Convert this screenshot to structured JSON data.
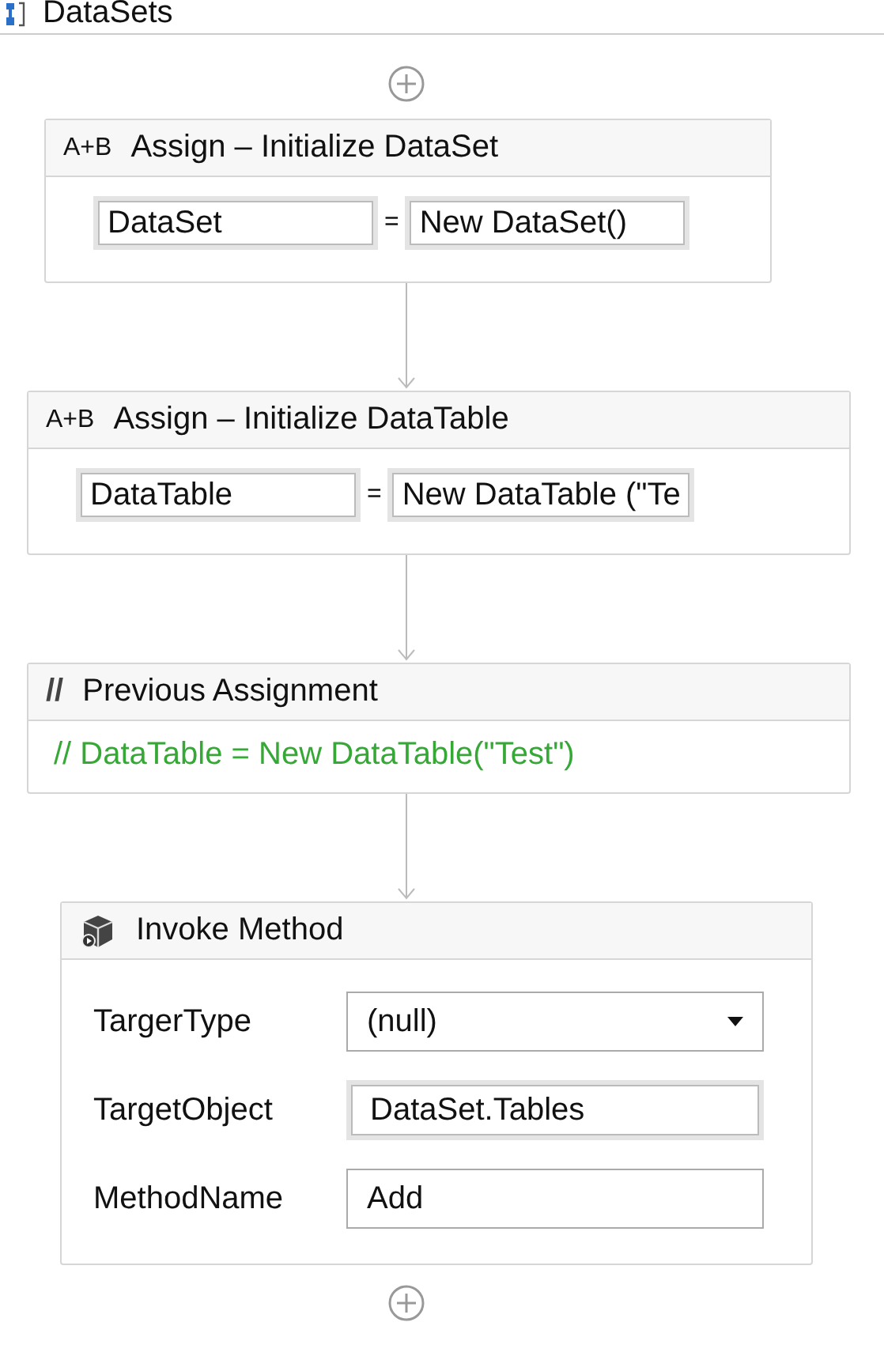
{
  "header": {
    "title": "DataSets"
  },
  "activities": [
    {
      "kind": "assign",
      "prefix": "A+B",
      "title": "Assign – Initialize DataSet",
      "to": "DataSet",
      "op": "=",
      "value": "New DataSet()"
    },
    {
      "kind": "assign",
      "prefix": "A+B",
      "title": "Assign – Initialize DataTable",
      "to": "DataTable",
      "op": "=",
      "value": "New DataTable (\"Te"
    },
    {
      "kind": "comment",
      "prefix": "//",
      "title": "Previous Assignment",
      "text": "// DataTable = New DataTable(\"Test\")"
    },
    {
      "kind": "invoke",
      "title": "Invoke Method",
      "properties": [
        {
          "kind": "dropdown",
          "label": "TargerType",
          "value": "(null)"
        },
        {
          "kind": "text",
          "label": "TargetObject",
          "value": "DataSet.Tables"
        },
        {
          "kind": "plain",
          "label": "MethodName",
          "value": "Add"
        }
      ]
    }
  ]
}
